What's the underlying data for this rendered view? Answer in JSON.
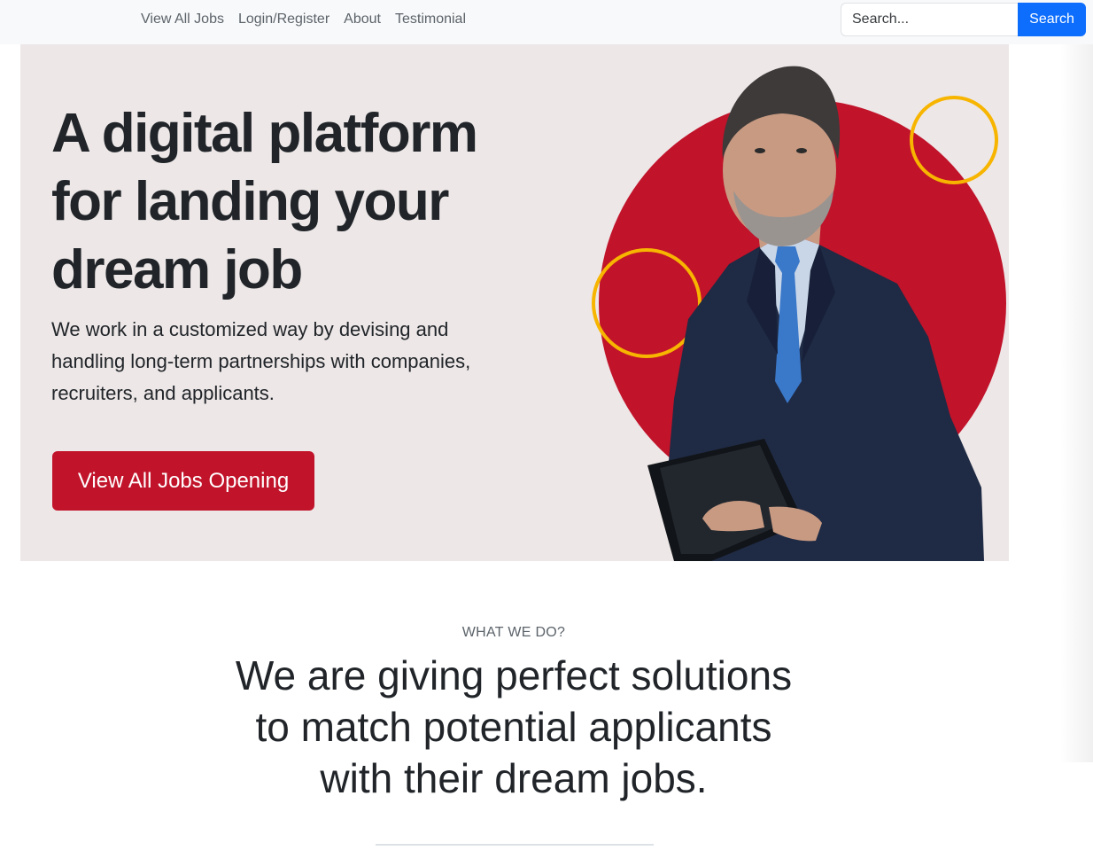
{
  "navbar": {
    "links": [
      "View All Jobs",
      "Login/Register",
      "About",
      "Testimonial"
    ],
    "search": {
      "placeholder": "Search...",
      "button_label": "Search"
    }
  },
  "hero": {
    "title": "A digital platform for landing your dream job",
    "description": "We work in a customized way by devising and handling long-term partnerships with companies, recruiters, and applicants.",
    "cta_label": "View All Jobs Opening",
    "image": "businessman-with-tablet-photo"
  },
  "what_we_do": {
    "eyebrow": "WHAT WE DO?",
    "heading": "We are giving perfect solutions to match potential applicants with their dream jobs."
  },
  "colors": {
    "accent_red": "#c1132a",
    "primary_blue": "#0d6efd",
    "ring_yellow": "#f7b500",
    "hero_bg": "#ede7e7"
  }
}
